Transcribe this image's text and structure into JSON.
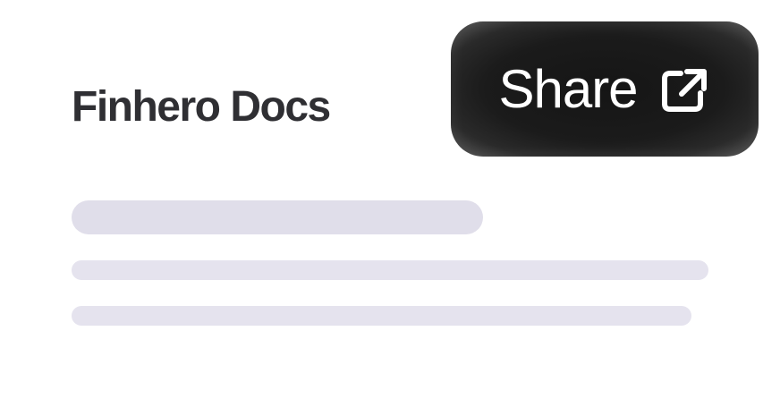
{
  "header": {
    "title": "Finhero Docs"
  },
  "share_button": {
    "label": "Share",
    "icon": "external-link-icon"
  },
  "colors": {
    "title_text": "#2f2f33",
    "button_background": "#1b1b1b",
    "button_text": "#ffffff",
    "skeleton": "#e5e3ee"
  }
}
